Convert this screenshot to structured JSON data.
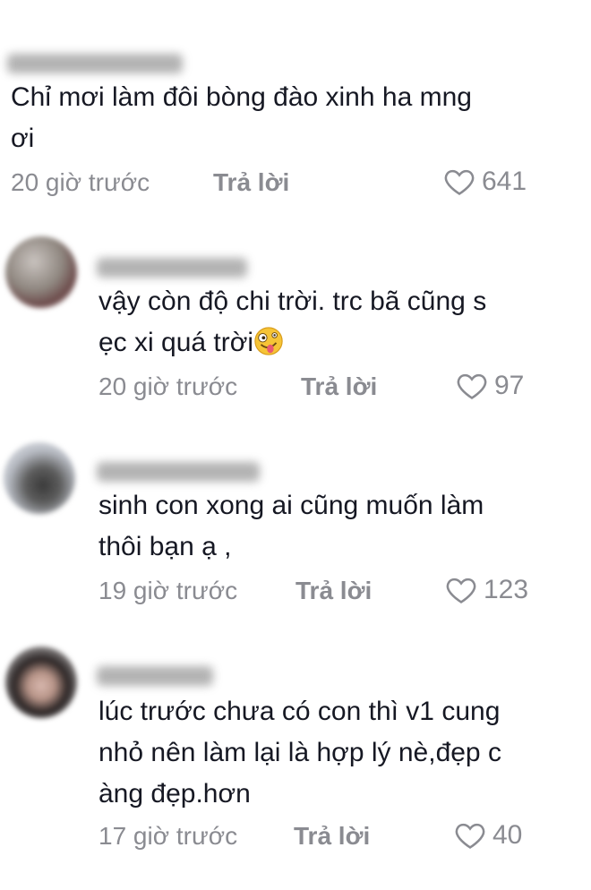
{
  "comments": [
    {
      "text": "Chỉ mơi làm đôi bòng đào xinh ha mng\nơi",
      "time": "20 giờ trước",
      "reply_label": "Trả lời",
      "likes": "641"
    },
    {
      "text": "vậy còn độ chi trời. trc bã cũng s\nẹc xi quá trời",
      "emoji": "zany-face-emoji",
      "time": "20 giờ trước",
      "reply_label": "Trả lời",
      "likes": "97"
    },
    {
      "text": "sinh con xong ai cũng muốn làm\nthôi bạn ạ ,",
      "time": "19 giờ trước",
      "reply_label": "Trả lời",
      "likes": "123"
    },
    {
      "text": "lúc trước chưa có con thì v1 cung\nnhỏ nên làm lại là hợp lý nè,đẹp c\nàng đẹp.hơn",
      "time": "17 giờ trước",
      "reply_label": "Trả lời",
      "likes": "40"
    }
  ],
  "colors": {
    "text": "#161823",
    "meta": "#8a8b91"
  },
  "icons": {
    "like": "heart-outline-icon"
  }
}
